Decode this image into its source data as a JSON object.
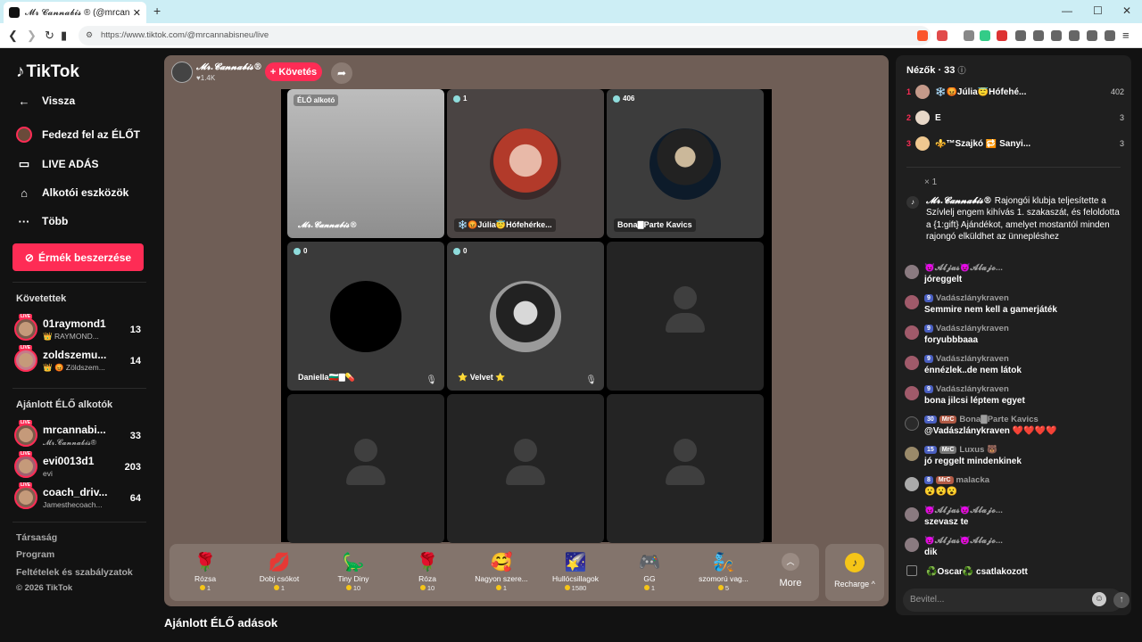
{
  "browser": {
    "tab_title": "𝓜𝓻 𝓒𝓪𝓷𝓷𝓪𝓫𝓲𝓼 ® (@mrcann",
    "url": "https://www.tiktok.com/@mrcannabisneu/live"
  },
  "sidebar": {
    "logo": "TikTok",
    "nav": [
      {
        "label": "Vissza",
        "icon": "arrow-left-icon"
      },
      {
        "label": "Fedezd fel az ÉLŐT",
        "icon": "explore-live-icon"
      },
      {
        "label": "LIVE ADÁS",
        "icon": "camera-icon"
      },
      {
        "label": "Alkotói eszközök",
        "icon": "creator-tools-icon"
      },
      {
        "label": "Több",
        "icon": "more-dots-icon"
      }
    ],
    "coins_button": "Érmék beszerzése",
    "following_title": "Követettek",
    "following": [
      {
        "name": "01raymond1",
        "sub": "👑 RAYMOND...",
        "count": "13"
      },
      {
        "name": "zoldszemu...",
        "sub": "👑 😡 Zöldszem...",
        "count": "14"
      }
    ],
    "recommended_title": "Ajánlott ÉLŐ alkotók",
    "recommended": [
      {
        "name": "mrcannabi...",
        "sub": "𝓜𝓻.𝓒𝓪𝓷𝓷𝓪𝓫𝓲𝓼®",
        "count": "33"
      },
      {
        "name": "evi0013d1",
        "sub": "evi",
        "count": "203"
      },
      {
        "name": "coach_driv...",
        "sub": "Jamesthecoach...",
        "count": "64"
      }
    ],
    "footer": [
      "Társaság",
      "Program",
      "Feltételek és szabályzatok",
      "© 2026 TikTok"
    ]
  },
  "host": {
    "name": "𝓜𝓻.𝓒𝓪𝓷𝓷𝓪𝓫𝓲𝓼®",
    "likes": "1.4K",
    "follow_label": "+ Követés"
  },
  "grid": [
    {
      "badge": "ÉLŐ alkotó",
      "label": "𝓜𝓻.𝓒𝓪𝓷𝓷𝓪𝓫𝓲𝓼®"
    },
    {
      "badge": "1",
      "label": "❄️😡Júlia😇Hófehérke..."
    },
    {
      "badge": "406",
      "label": "Bona🀫Parte Kavics"
    },
    {
      "badge": "0",
      "label": "Daniella🇧🇬🀫💊"
    },
    {
      "badge": "0",
      "label": "⭐ Velvet ⭐"
    }
  ],
  "gifts": [
    {
      "name": "Rózsa",
      "price": "1",
      "icon": "🌹"
    },
    {
      "name": "Dobj csókot",
      "price": "1",
      "icon": "💋"
    },
    {
      "name": "Tiny Diny",
      "price": "10",
      "icon": "🦕"
    },
    {
      "name": "Róza",
      "price": "10",
      "icon": "🌹"
    },
    {
      "name": "Nagyon szere...",
      "price": "1",
      "icon": "🥰"
    },
    {
      "name": "Hullócsillagok",
      "price": "1580",
      "icon": "🌠"
    },
    {
      "name": "GG",
      "price": "1",
      "icon": "🎮"
    },
    {
      "name": "szomorú vag...",
      "price": "5",
      "icon": "🧞"
    }
  ],
  "more_label": "More",
  "recharge_label": "Recharge ^",
  "recommended_live_title": "Ajánlott ÉLŐ adások",
  "viewers": {
    "title": "Nézők · 33",
    "rows": [
      {
        "rank": "1",
        "name": "❄️😡Júlia😇Hófehé...",
        "score": "402"
      },
      {
        "rank": "2",
        "name": "E",
        "score": "3"
      },
      {
        "rank": "3",
        "name": "⚜️™Szajkó 🔁 Sanyi...",
        "score": "3"
      }
    ]
  },
  "chat": {
    "x1": "× 1",
    "system_user": "𝓜𝓻.𝓒𝓪𝓷𝓷𝓪𝓫𝓲𝓼®",
    "system_text": " Rajongói klubja teljesítette a Szívlelj engem kihívás 1. szakaszát, és feloldotta a {1:gift} Ajándékot, amelyet mostantól minden rajongó elküldhet az ünnepléshez",
    "messages": [
      {
        "user": "😈𝓐𝓵𝓳𝓪𝓼😈𝓐𝓵𝓪𝓳𝓸...",
        "level": "",
        "club": "",
        "text": "jóreggelt"
      },
      {
        "user": "Vadászlánykraven",
        "level": "9",
        "club": "",
        "text": "Semmire nem kell a gamerjáték"
      },
      {
        "user": "Vadászlánykraven",
        "level": "9",
        "club": "",
        "text": "foryubbbaaa"
      },
      {
        "user": "Vadászlánykraven",
        "level": "9",
        "club": "",
        "text": "énnézlek..de nem látok"
      },
      {
        "user": "Vadászlánykraven",
        "level": "9",
        "club": "",
        "text": "bona jilcsi léptem egyet"
      },
      {
        "user": "Bona🀫Parte Kavics",
        "level": "30",
        "club": "MrC",
        "text": "@Vadászlánykraven ❤️❤️❤️❤️"
      },
      {
        "user": "Luxus 🐻",
        "level": "15",
        "club": "MrC",
        "text": "jó reggelt mindenkinek"
      },
      {
        "user": "malacka",
        "level": "8",
        "club": "MrC",
        "text": "😮😮😮"
      },
      {
        "user": "😈𝓐𝓵𝓳𝓪𝓼😈𝓐𝓵𝓪𝓳𝓸...",
        "level": "",
        "club": "",
        "text": "szevasz te"
      },
      {
        "user": "😈𝓐𝓵𝓳𝓪𝓼😈𝓐𝓵𝓪𝓳𝓸...",
        "level": "",
        "club": "",
        "text": "dik"
      }
    ],
    "join_text": "♻️Oscar♻️   csatlakozott",
    "input_placeholder": "Bevitel..."
  }
}
